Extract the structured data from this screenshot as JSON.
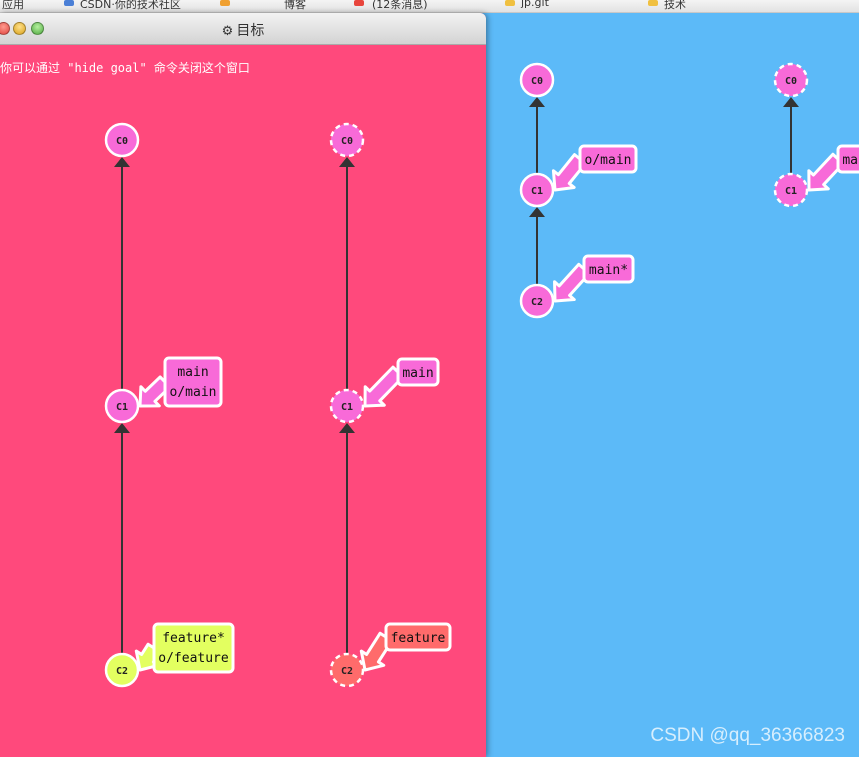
{
  "browser_bar": {
    "fragments": [
      "应用",
      "CSDN·你的技术社区",
      "博客",
      "(12条消息)",
      "jp.git",
      "技术"
    ]
  },
  "window": {
    "title": "目标",
    "gear_icon": "gear-icon",
    "hint": "你可以通过 \"hide goal\" 命令关闭这个窗口"
  },
  "goal": {
    "local": {
      "nodes": [
        {
          "id": "C0",
          "label": "C0",
          "style": "solid",
          "color": "#f86ad8"
        },
        {
          "id": "C1",
          "label": "C1",
          "style": "solid",
          "color": "#f86ad8"
        },
        {
          "id": "C2",
          "label": "C2",
          "style": "solid",
          "color": "#e3ff60"
        }
      ],
      "tags": [
        {
          "target": "C1",
          "lines": [
            "main",
            "o/main"
          ],
          "color": "#f86ad8"
        },
        {
          "target": "C2",
          "lines": [
            "feature*",
            "o/feature"
          ],
          "color": "#e3ff60"
        }
      ]
    },
    "remote": {
      "nodes": [
        {
          "id": "C0",
          "label": "C0",
          "style": "dashed",
          "color": "#f86ad8"
        },
        {
          "id": "C1",
          "label": "C1",
          "style": "dashed",
          "color": "#f86ad8"
        },
        {
          "id": "C2",
          "label": "C2",
          "style": "dashed",
          "color": "#ff6b6b"
        }
      ],
      "tags": [
        {
          "target": "C1",
          "lines": [
            "main"
          ],
          "color": "#f86ad8"
        },
        {
          "target": "C2",
          "lines": [
            "feature"
          ],
          "color": "#ff6b6b"
        }
      ]
    }
  },
  "current": {
    "local": {
      "nodes": [
        {
          "id": "C0",
          "label": "C0",
          "style": "solid"
        },
        {
          "id": "C1",
          "label": "C1",
          "style": "solid"
        },
        {
          "id": "C2",
          "label": "C2",
          "style": "solid"
        }
      ],
      "tags": [
        {
          "target": "C1",
          "lines": [
            "o/main"
          ]
        },
        {
          "target": "C2",
          "lines": [
            "main*"
          ]
        }
      ]
    },
    "remote": {
      "nodes": [
        {
          "id": "C0",
          "label": "C0",
          "style": "dashed"
        },
        {
          "id": "C1",
          "label": "C1",
          "style": "dashed"
        }
      ],
      "tags": [
        {
          "target": "C1",
          "lines": [
            "main"
          ]
        }
      ]
    }
  },
  "watermark": "CSDN @qq_36366823",
  "colors": {
    "goal_background": "#ff497c",
    "canvas_background": "#5cbaf8",
    "commit_pink": "#f86ad8",
    "commit_lime": "#e3ff60",
    "commit_coral": "#ff6b6b",
    "edge": "#333333"
  }
}
